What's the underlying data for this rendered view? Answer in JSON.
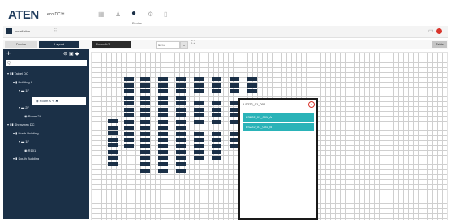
{
  "app": {
    "logo": "ATEN",
    "logo_sub": "eco DC™",
    "nav_device_label": "Device"
  },
  "toolbar": {
    "section_label": "Installation",
    "right_button": "Table"
  },
  "sidebar": {
    "tabs": [
      "Device",
      "Layout"
    ],
    "search_placeholder": "Q",
    "tree": [
      {
        "label": "Taipei DC",
        "indent": 0
      },
      {
        "label": "Building A",
        "indent": 1
      },
      {
        "label": "1F",
        "indent": 2
      },
      {
        "label": "Room A",
        "indent": 3,
        "selected": true
      },
      {
        "label": "2F",
        "indent": 2
      },
      {
        "label": "Room 2A",
        "indent": 3
      },
      {
        "label": "Shenzhen DC",
        "indent": 0
      },
      {
        "label": "North Building",
        "indent": 1
      },
      {
        "label": "1F",
        "indent": 2
      },
      {
        "label": "R101",
        "indent": 3
      },
      {
        "label": "South Building",
        "indent": 1
      }
    ]
  },
  "map": {
    "tab_label": "Room A/1",
    "zoom_value": "50%",
    "zoom_btn": "▾"
  },
  "popup": {
    "title": "LS222_01_002",
    "close_icon": "×",
    "items": [
      "LS222_01_001_A",
      "LS222_01_001_B"
    ]
  }
}
